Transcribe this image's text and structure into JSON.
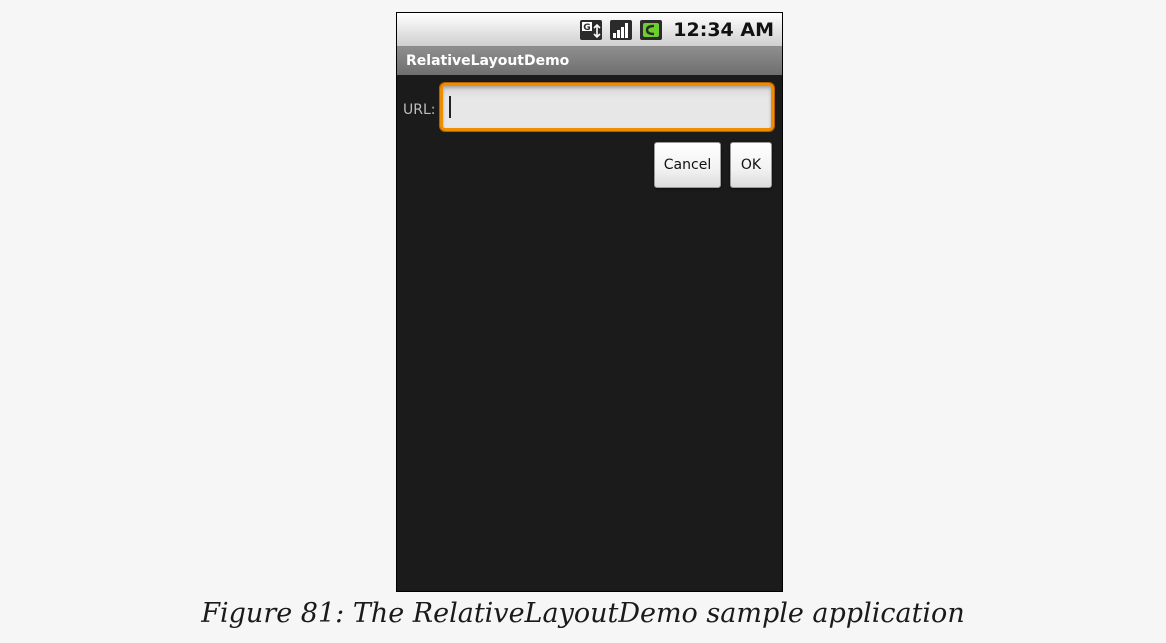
{
  "status_bar": {
    "icons": [
      "network-type-icon",
      "signal-bars-icon",
      "battery-icon"
    ],
    "time": "12:34 AM"
  },
  "app": {
    "title": "RelativeLayoutDemo"
  },
  "form": {
    "url_label": "URL:",
    "url_value": "",
    "url_placeholder": "",
    "cancel_label": "Cancel",
    "ok_label": "OK"
  },
  "caption": "Figure 81: The RelativeLayoutDemo sample application",
  "colors": {
    "focus_border": "#f08c00",
    "screen_background": "#1b1b1b",
    "title_bar": "#7f7f7f"
  }
}
